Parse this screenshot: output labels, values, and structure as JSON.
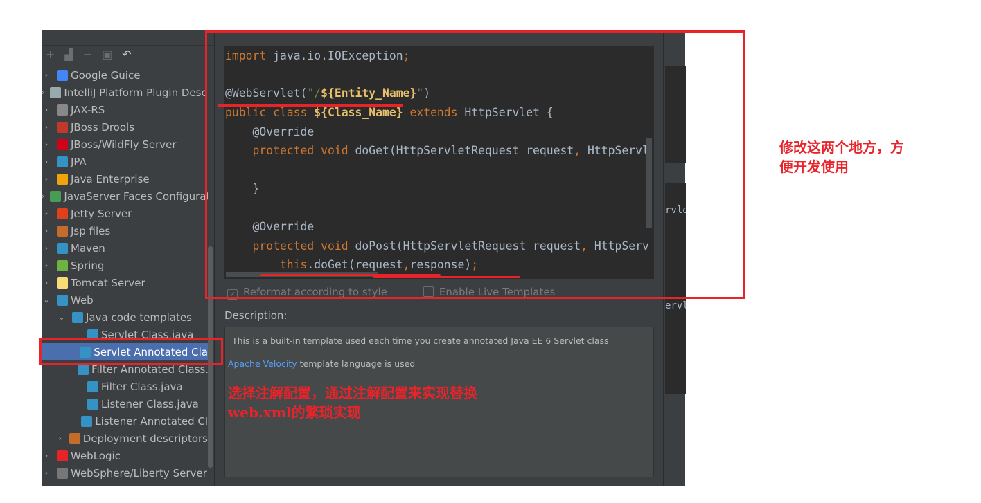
{
  "sidebar": {
    "toolbar": [
      "+",
      "add-group",
      "−",
      "copy",
      "↶"
    ],
    "items": [
      {
        "label": "Google Guice",
        "icon": "google-icon",
        "color": "#4285f4"
      },
      {
        "label": "IntelliJ Platform Plugin Descr",
        "icon": "plugin-icon",
        "color": "#9aa"
      },
      {
        "label": "JAX-RS",
        "icon": "globe-icon",
        "color": "#888"
      },
      {
        "label": "JBoss Drools",
        "icon": "drools-icon",
        "color": "#c0392b"
      },
      {
        "label": "JBoss/WildFly Server",
        "icon": "wildfly-icon",
        "color": "#d0021b"
      },
      {
        "label": "JPA",
        "icon": "jpa-icon",
        "color": "#3592c4"
      },
      {
        "label": "Java Enterprise",
        "icon": "java-ee-icon",
        "color": "#f0a30a"
      },
      {
        "label": "JavaServer Faces Configurati",
        "icon": "jsf-icon",
        "color": "#499c54"
      },
      {
        "label": "Jetty Server",
        "icon": "jetty-icon",
        "color": "#e0401a"
      },
      {
        "label": "Jsp files",
        "icon": "jsp-icon",
        "color": "#c56b2b"
      },
      {
        "label": "Maven",
        "icon": "maven-icon",
        "color": "#3592c4"
      },
      {
        "label": "Spring",
        "icon": "spring-icon",
        "color": "#6db33f"
      },
      {
        "label": "Tomcat Server",
        "icon": "tomcat-icon",
        "color": "#f8dc75"
      },
      {
        "label": "Web",
        "icon": "web-icon",
        "color": "#3592c4"
      },
      {
        "label": "Java code templates",
        "icon": "template-folder-icon",
        "color": "#3592c4"
      },
      {
        "label": "Servlet Class.java",
        "icon": "java-template-icon",
        "color": "#3592c4"
      },
      {
        "label": "Servlet Annotated Cla",
        "icon": "java-template-icon",
        "color": "#3592c4"
      },
      {
        "label": "Filter Annotated Class.",
        "icon": "java-template-icon",
        "color": "#3592c4"
      },
      {
        "label": "Filter Class.java",
        "icon": "java-template-icon",
        "color": "#3592c4"
      },
      {
        "label": "Listener Class.java",
        "icon": "java-template-icon",
        "color": "#3592c4"
      },
      {
        "label": "Listener Annotated Cl",
        "icon": "java-template-icon",
        "color": "#3592c4"
      },
      {
        "label": "Deployment descriptors",
        "icon": "xml-folder-icon",
        "color": "#c56b2b"
      },
      {
        "label": "WebLogic",
        "icon": "weblogic-icon",
        "color": "#e8242a"
      },
      {
        "label": "WebSphere/Liberty Server",
        "icon": "websphere-icon",
        "color": "#777"
      }
    ]
  },
  "editor": {
    "l1": {
      "kw": "import",
      "rest": " java.io.IOException",
      "semi": ";"
    },
    "l2": {
      "a": "@WebServlet(",
      "q1": "\"/",
      "v": "${Entity_Name}",
      "q2": "\"",
      "b": ")"
    },
    "l3": {
      "k1": "public class ",
      "v": "${Class_Name}",
      "k2": " extends",
      "rest": " HttpServlet {"
    },
    "l4": "    @Override",
    "l5": {
      "k": "    protected void",
      "rest": " doGet(HttpServletRequest request",
      "c": ",",
      "rest2": " HttpServl"
    },
    "l6": "    }",
    "l7": "    @Override",
    "l8": {
      "k": "    protected void",
      "rest": " doPost(HttpServletRequest request",
      "c": ",",
      "rest2": " HttpServ"
    },
    "l9": {
      "k": "        this",
      "rest": ".doGet(request",
      "c": ",",
      "rest2": "response)",
      "semi": ";"
    }
  },
  "options": {
    "reformat": "Reformat according to style",
    "live": "Enable Live Templates"
  },
  "description": {
    "label": "Description:",
    "text": "This is a built-in template used each time you create annotated Java EE 6 Servlet class",
    "link": "Apache Velocity",
    "link_suffix": " template language is used"
  },
  "right_strip": {
    "a": "rvle",
    "b": "ervl"
  },
  "annotations": {
    "right_note_1": "修改这两个地方，方",
    "right_note_2": "便开发使用",
    "bottom_note_1": "选择注解配置，通过注解配置来实现替换",
    "bottom_note_2": "web.xml的繁琐实现",
    "color": "#e8242a"
  }
}
